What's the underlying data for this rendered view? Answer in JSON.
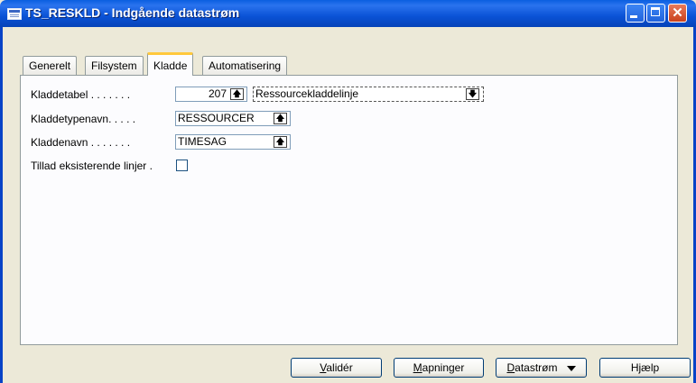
{
  "window": {
    "title": "TS_RESKLD - Indgående datastrøm"
  },
  "tabs": [
    {
      "label": "Generelt",
      "active": false
    },
    {
      "label": "Filsystem",
      "active": false
    },
    {
      "label": "Kladde",
      "active": true
    },
    {
      "label": "Automatisering",
      "active": false
    }
  ],
  "form": {
    "kladdetabel": {
      "label": "Kladdetabel . . . . . . .",
      "value": "207",
      "description": "Ressourcekladdelinje"
    },
    "kladdetypenavn": {
      "label": "Kladdetypenavn. . . . .",
      "value": "RESSOURCER"
    },
    "kladdenavn": {
      "label": "Kladdenavn . . . . . . .",
      "value": "TIMESAG"
    },
    "tillad": {
      "label": "Tillad eksisterende linjer .",
      "checked": false
    }
  },
  "buttons": {
    "valider": {
      "pre": "",
      "u": "V",
      "post": "alidér"
    },
    "mapninger": {
      "pre": "",
      "u": "M",
      "post": "apninger"
    },
    "datastrom": {
      "pre": "",
      "u": "D",
      "post": "atastrøm"
    },
    "hjaelp": {
      "label": "Hjælp"
    }
  },
  "colors": {
    "titlebar": "#0a52d6",
    "window_bg": "#ece9d8",
    "active_tab_accent": "#ffc83c"
  },
  "icons": {
    "lookup": "up-arrow-icon",
    "dropdown": "down-arrow-icon"
  }
}
